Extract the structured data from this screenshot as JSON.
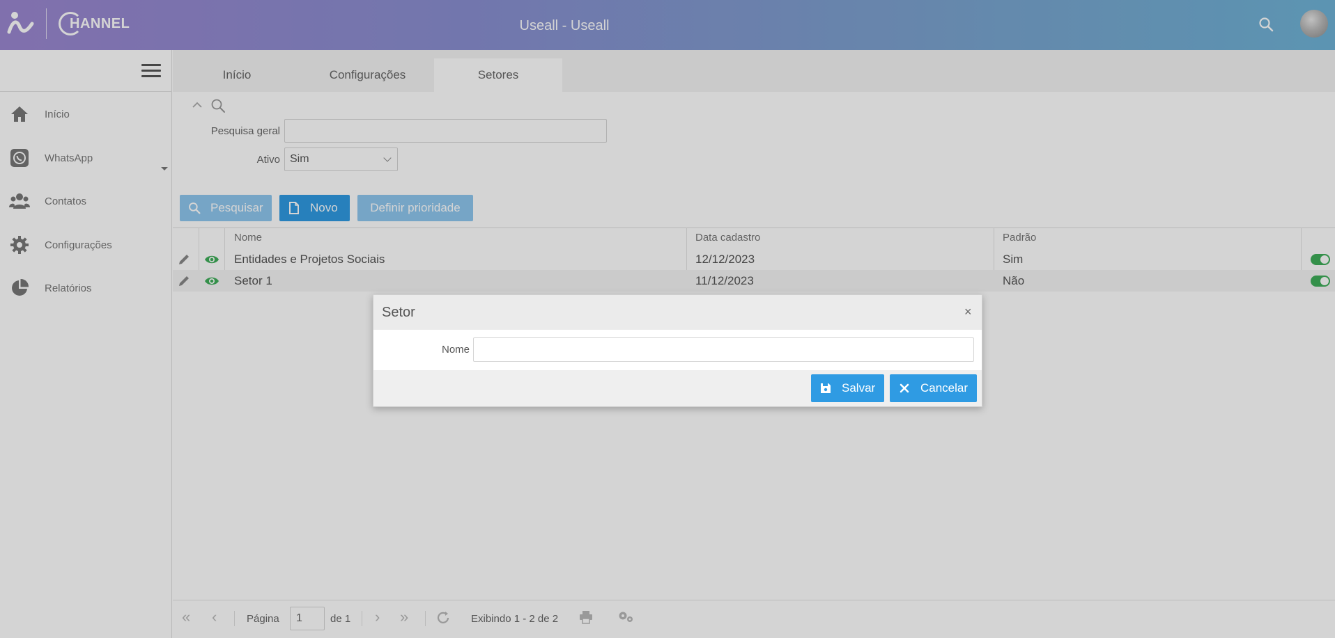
{
  "header": {
    "logo_text": "HANNEL",
    "title": "Useall - Useall"
  },
  "sidebar": {
    "items": [
      {
        "label": "Início",
        "icon": "home-icon"
      },
      {
        "label": "WhatsApp",
        "icon": "whatsapp-icon"
      },
      {
        "label": "Contatos",
        "icon": "contacts-icon"
      },
      {
        "label": "Configurações",
        "icon": "gear-icon"
      },
      {
        "label": "Relatórios",
        "icon": "pie-chart-icon"
      }
    ]
  },
  "tabs": [
    {
      "label": "Início",
      "active": false
    },
    {
      "label": "Configurações",
      "active": false
    },
    {
      "label": "Setores",
      "active": true
    }
  ],
  "filters": {
    "search_label": "Pesquisa geral",
    "search_value": "",
    "active_label": "Ativo",
    "active_value": "Sim"
  },
  "toolbar": {
    "search_label": "Pesquisar",
    "new_label": "Novo",
    "priority_label": "Definir prioridade"
  },
  "grid": {
    "columns": [
      "Nome",
      "Data cadastro",
      "Padrão"
    ],
    "rows": [
      {
        "nome": "Entidades e Projetos Sociais",
        "data": "12/12/2023",
        "padrao": "Sim",
        "active": true
      },
      {
        "nome": "Setor 1",
        "data": "11/12/2023",
        "padrao": "Não",
        "active": true
      }
    ]
  },
  "pager": {
    "page_label": "Página",
    "page_value": "1",
    "of_label": "de 1",
    "showing": "Exibindo 1 - 2 de 2"
  },
  "modal": {
    "title": "Setor",
    "close": "×",
    "field_label": "Nome",
    "field_value": "",
    "save_label": "Salvar",
    "cancel_label": "Cancelar"
  },
  "colors": {
    "primary": "#2f9be3",
    "primary_light": "#8fc7ef",
    "toggle_on": "#3fae5a",
    "eye": "#3fae5a"
  }
}
